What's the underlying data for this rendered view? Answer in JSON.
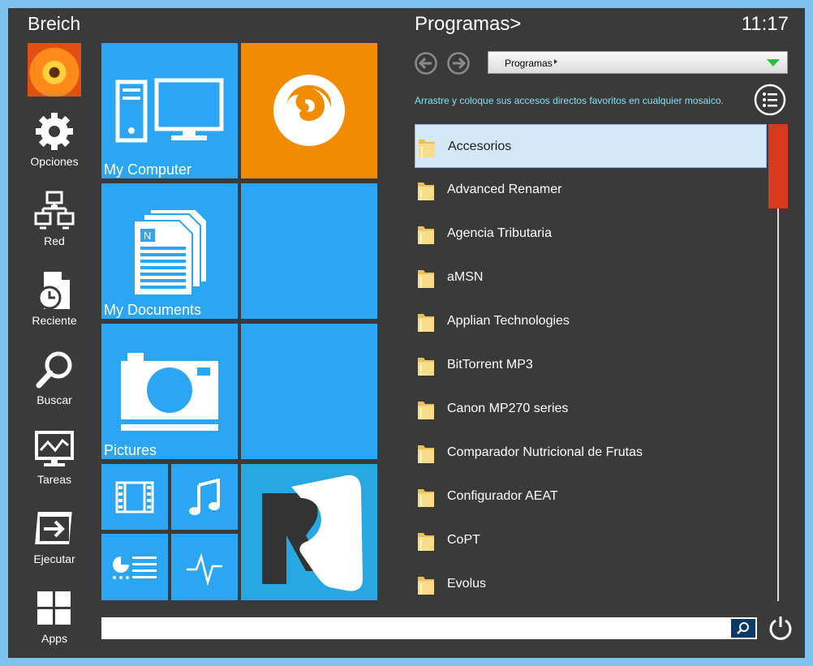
{
  "user": {
    "name": "Breich"
  },
  "sidebar": {
    "items": [
      {
        "label": "Opciones",
        "icon": "gear-icon"
      },
      {
        "label": "Red",
        "icon": "network-icon"
      },
      {
        "label": "Reciente",
        "icon": "recent-icon"
      },
      {
        "label": "Buscar",
        "icon": "search-icon"
      },
      {
        "label": "Tareas",
        "icon": "task-manager-icon"
      },
      {
        "label": "Ejecutar",
        "icon": "run-icon"
      },
      {
        "label": "Apps",
        "icon": "apps-grid-icon"
      }
    ]
  },
  "tiles": [
    {
      "label": "My Computer",
      "icon": "computer-icon",
      "color": "#2aa6f4"
    },
    {
      "label": "",
      "icon": "firefox-icon",
      "color": "#f18c00"
    },
    {
      "label": "My Documents",
      "icon": "documents-icon",
      "color": "#2aa6f4"
    },
    {
      "label": "",
      "icon": "",
      "color": "#2aa6f4"
    },
    {
      "label": "Pictures",
      "icon": "camera-icon",
      "color": "#2aa6f4"
    },
    {
      "label": "",
      "icon": "",
      "color": "#2aa6f4"
    },
    {
      "label": "",
      "icon": "film-icon",
      "color": "#2aa6f4"
    },
    {
      "label": "",
      "icon": "music-icon",
      "color": "#2aa6f4"
    },
    {
      "label": "",
      "icon": "control-panel-icon",
      "color": "#2aa6f4"
    },
    {
      "label": "",
      "icon": "pulse-icon",
      "color": "#2aa6f4"
    },
    {
      "label": "",
      "icon": "app-r-logo-icon",
      "color": "#2aa6f4"
    }
  ],
  "programs": {
    "title": "Programas>",
    "clock": "11:17",
    "path_label": "Programas",
    "hint": "Arrastre y coloque sus accesos directos favoritos en cualquier mosaico.",
    "items": [
      "Accesorios",
      "Advanced Renamer",
      "Agencia Tributaria",
      "aMSN",
      "Applian Technologies",
      "BitTorrent MP3",
      "Canon MP270 series",
      "Comparador Nutricional de Frutas",
      "Configurador AEAT",
      "CoPT",
      "Evolus"
    ],
    "selected_index": 0
  },
  "search": {
    "value": "",
    "placeholder": ""
  },
  "colors": {
    "background": "#3a3a3a",
    "frame": "#7ec3ee",
    "tile_blue": "#2aa6f4",
    "tile_orange": "#f18c00",
    "scroll_thumb": "#d93a1e",
    "hint_text": "#7fe3ee",
    "selection": "#d5e8f9"
  }
}
